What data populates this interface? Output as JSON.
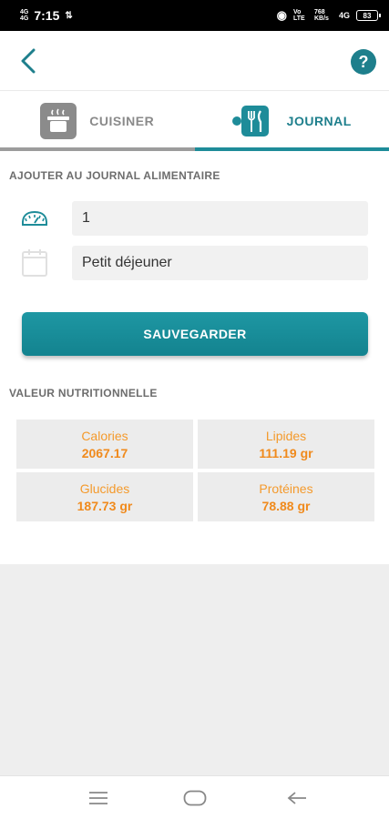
{
  "status_bar": {
    "net_top": "4G",
    "net_bottom": "4G",
    "time": "7:15",
    "extra_icon": "signal-arrows",
    "right_small": "Vo LTE",
    "speed": "768 KB/s",
    "signal": "4G",
    "battery": "83"
  },
  "header": {
    "help_label": "?"
  },
  "tabs": [
    {
      "label": "CUISINER",
      "icon": "cooking-pot-icon",
      "active": false
    },
    {
      "label": "JOURNAL",
      "icon": "plate-cutlery-icon",
      "active": true
    }
  ],
  "journal": {
    "title": "AJOUTER AU JOURNAL ALIMENTAIRE",
    "quantity_value": "1",
    "meal_value": "Petit déjeuner",
    "save_label": "SAUVEGARDER"
  },
  "nutrition": {
    "title": "VALEUR NUTRITIONNELLE",
    "items": [
      {
        "label": "Calories",
        "value": "2067.17"
      },
      {
        "label": "Lipides",
        "value": "111.19 gr"
      },
      {
        "label": "Glucides",
        "value": "187.73 gr"
      },
      {
        "label": "Protéines",
        "value": "78.88 gr"
      }
    ]
  },
  "colors": {
    "accent": "#1e8c99",
    "nutrition_text": "#f49a2c",
    "inactive": "#8b8b8b"
  }
}
